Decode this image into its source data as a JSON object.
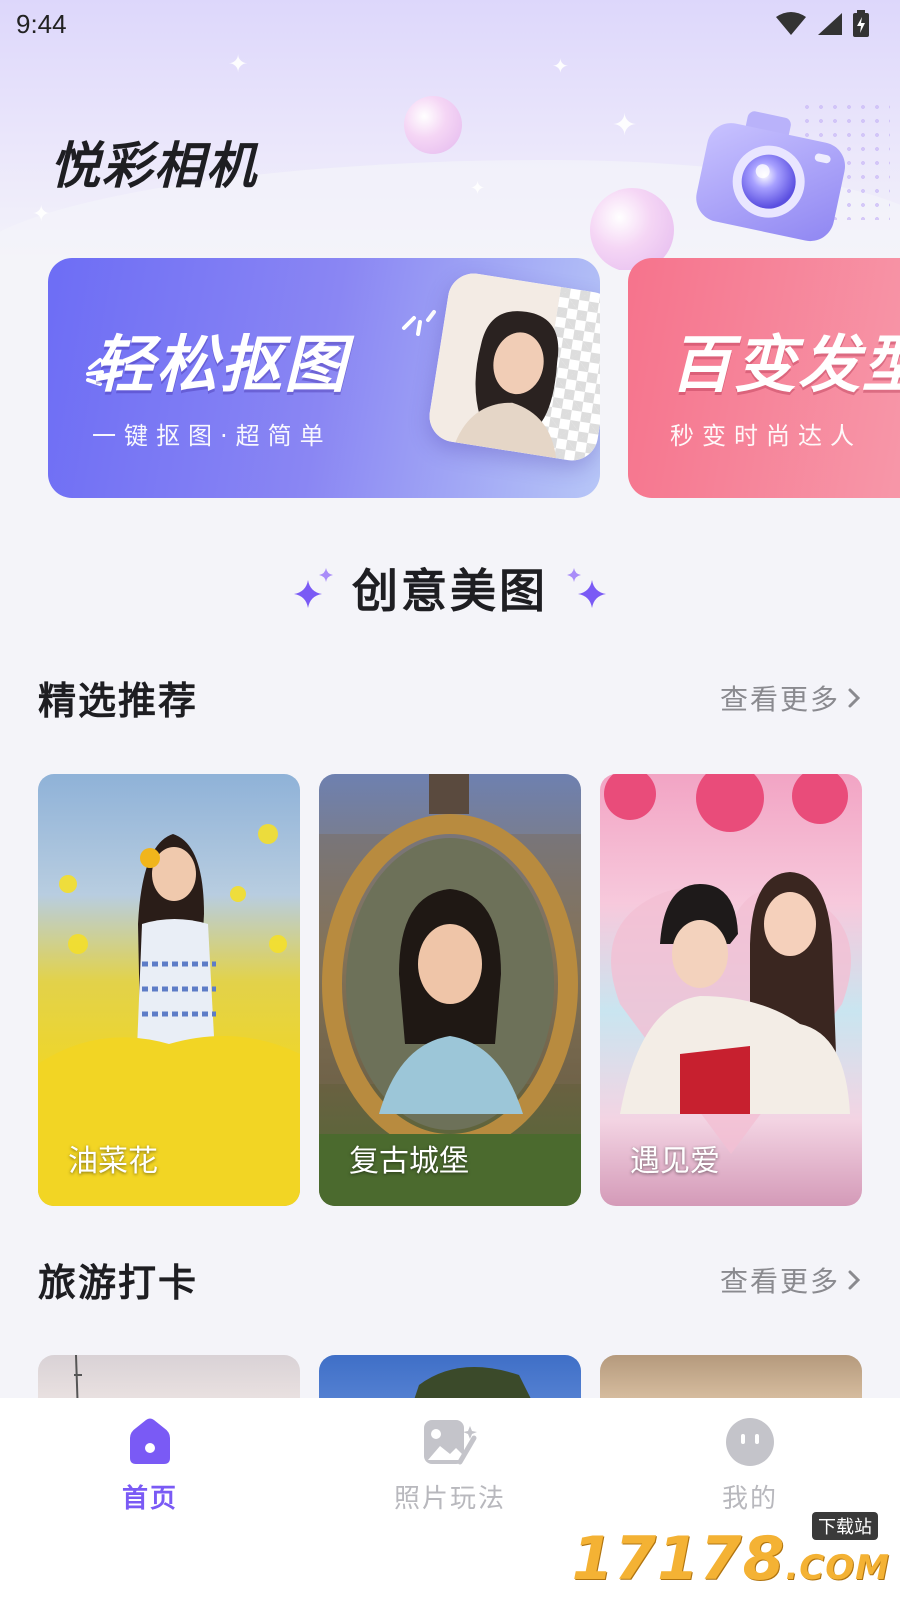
{
  "status": {
    "time": "9:44"
  },
  "app": {
    "title": "悦彩相机"
  },
  "banners": [
    {
      "title": "轻松抠图",
      "subtitle": "一键抠图·超简单"
    },
    {
      "title": "百变发型",
      "subtitle": "秒变时尚达人"
    }
  ],
  "creative": {
    "title": "创意美图"
  },
  "featured": {
    "title": "精选推荐",
    "more": "查看更多",
    "cards": [
      {
        "label": "油菜花"
      },
      {
        "label": "复古城堡"
      },
      {
        "label": "遇见爱"
      }
    ]
  },
  "travel": {
    "title": "旅游打卡",
    "more": "查看更多"
  },
  "tabs": [
    {
      "label": "首页",
      "icon": "home-icon",
      "active": true
    },
    {
      "label": "照片玩法",
      "icon": "photo-magic-icon",
      "active": false
    },
    {
      "label": "我的",
      "icon": "profile-icon",
      "active": false
    }
  ],
  "watermark": {
    "text": "17178",
    "suffix": ".COM",
    "badge": "下载站"
  },
  "colors": {
    "accent": "#7a5af5",
    "banner1": "#6d6df5",
    "banner2": "#f6738c"
  }
}
